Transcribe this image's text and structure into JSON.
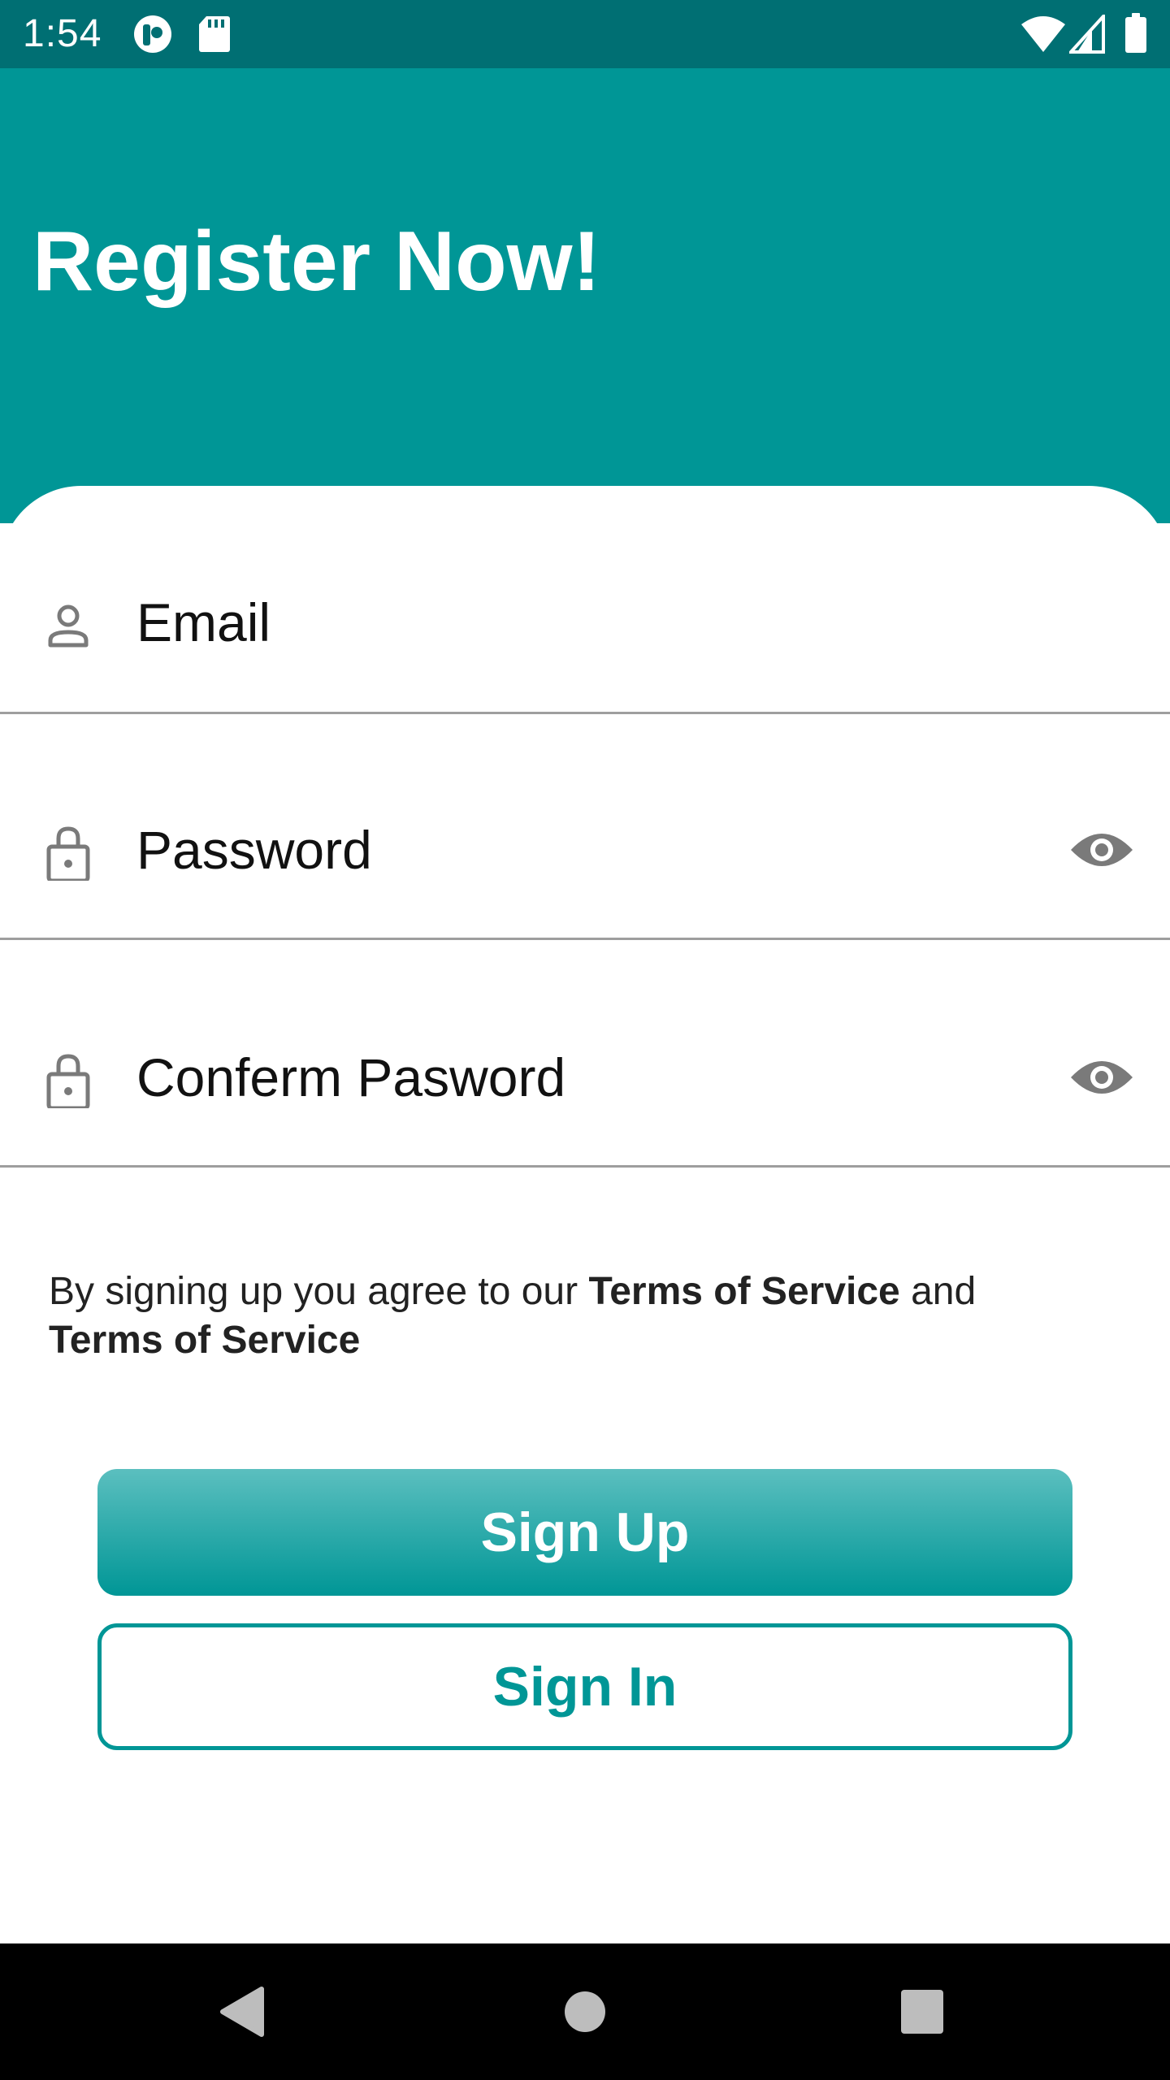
{
  "status_bar": {
    "time": "1:54",
    "icons": [
      "app-notification-icon",
      "sd-card-icon",
      "wifi-icon",
      "cell-signal-icon",
      "battery-icon"
    ]
  },
  "header": {
    "title": "Register Now!",
    "background_color": "#009696"
  },
  "form": {
    "email": {
      "placeholder": "Email",
      "icon": "person-icon"
    },
    "password": {
      "placeholder": "Password",
      "icon": "lock-icon",
      "toggle_icon": "eye-icon"
    },
    "confirm_password": {
      "placeholder": "Conferm Pasword",
      "icon": "lock-icon",
      "toggle_icon": "eye-icon"
    }
  },
  "terms": {
    "prefix": "By signing up you agree to our",
    "link1": "Terms of Service",
    "middle": "and",
    "link2": "Terms of Service"
  },
  "buttons": {
    "sign_up": "Sign Up",
    "sign_in": "Sign In"
  },
  "nav_bar": {
    "icons": [
      "back-icon",
      "home-icon",
      "recents-icon"
    ]
  },
  "colors": {
    "accent": "#009696",
    "status_bar": "#006F73"
  }
}
